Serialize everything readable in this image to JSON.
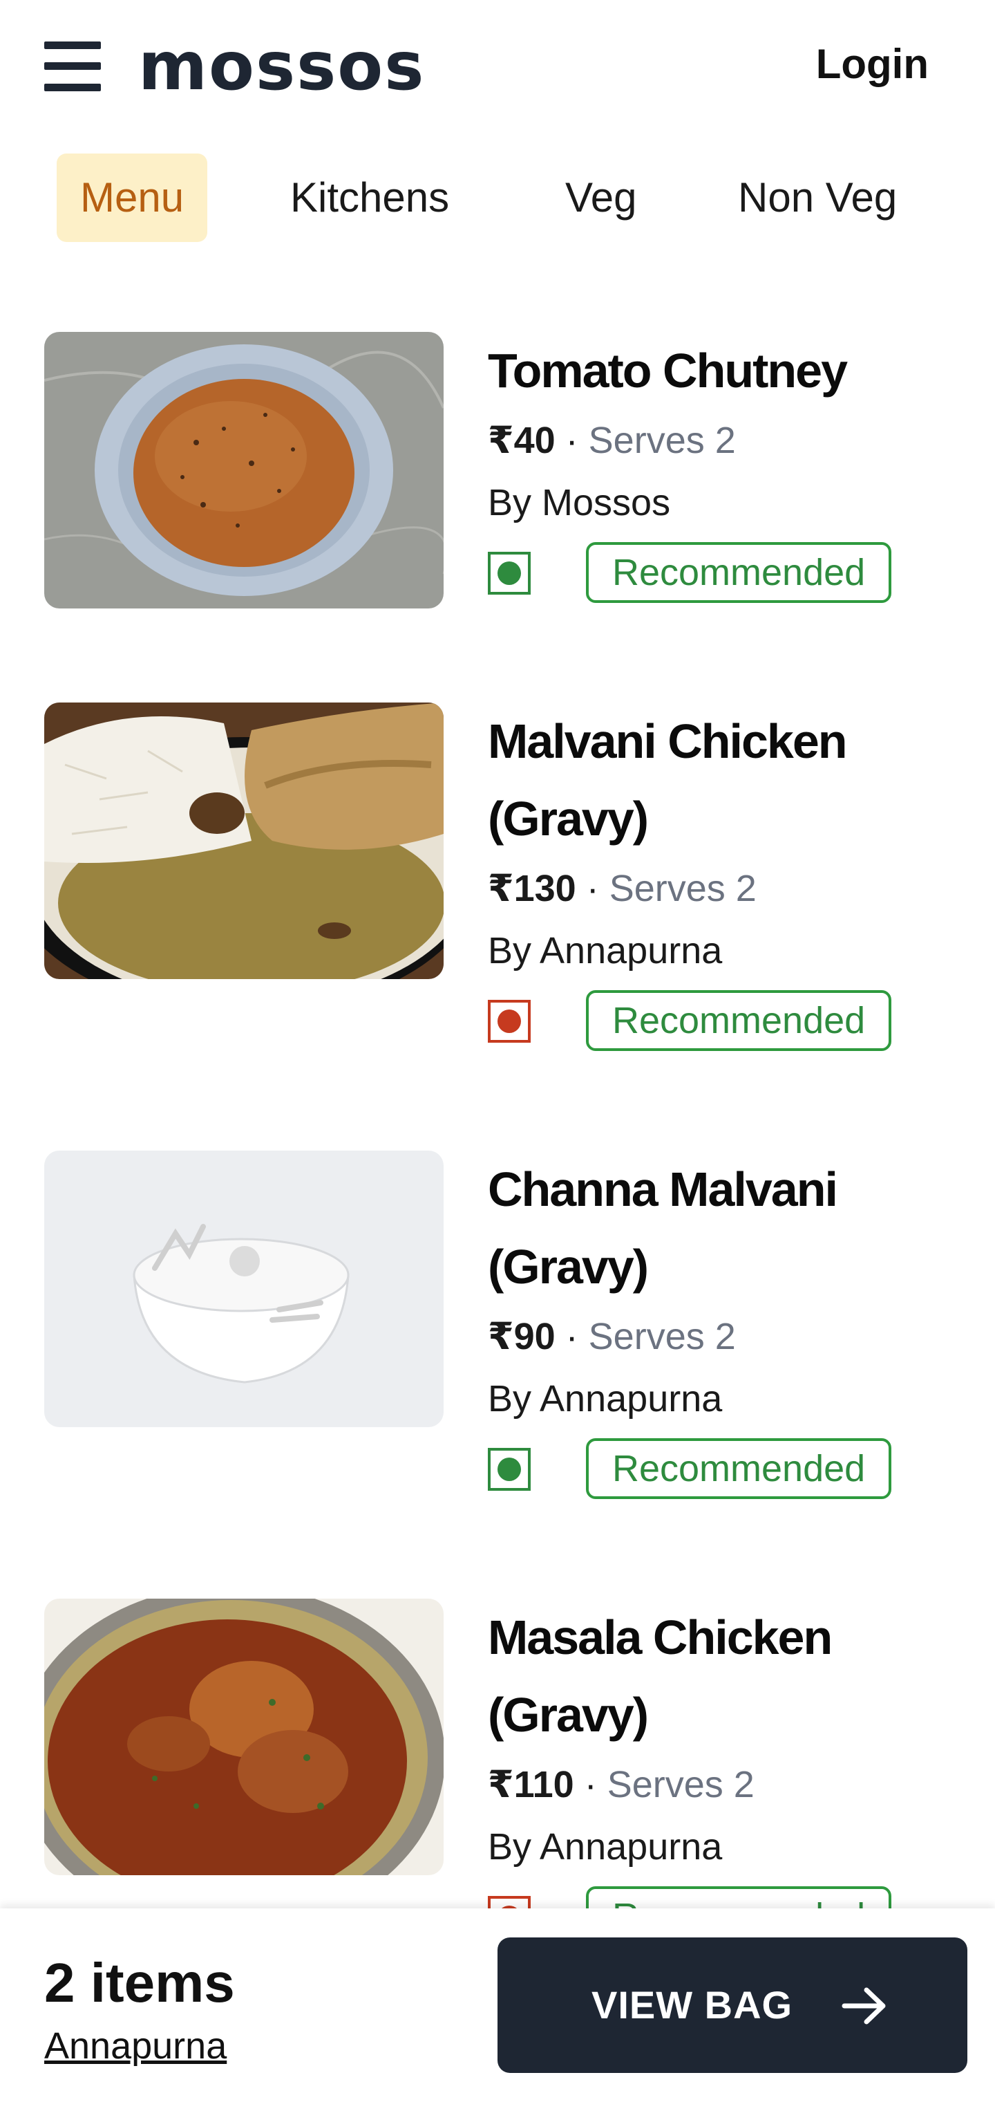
{
  "header": {
    "logo": "mossos",
    "login_label": "Login"
  },
  "tabs": [
    {
      "label": "Menu",
      "active": true
    },
    {
      "label": "Kitchens",
      "active": false
    },
    {
      "label": "Veg",
      "active": false
    },
    {
      "label": "Non Veg",
      "active": false
    }
  ],
  "items": [
    {
      "name": "Tomato Chutney",
      "price": "₹40",
      "sep": "·",
      "serves": "Serves 2",
      "by": "By Mossos",
      "diet": "veg",
      "badge": "Recommended"
    },
    {
      "name_line1": "Malvani Chicken",
      "name_line2": "(Gravy)",
      "price": "₹130",
      "sep": "·",
      "serves": "Serves 2",
      "by": "By Annapurna",
      "diet": "nonveg",
      "badge": "Recommended"
    },
    {
      "name_line1": "Channa Malvani",
      "name_line2": "(Gravy)",
      "price": "₹90",
      "sep": "·",
      "serves": "Serves 2",
      "by": "By Annapurna",
      "diet": "veg",
      "badge": "Recommended"
    },
    {
      "name_line1": "Masala Chicken",
      "name_line2": "(Gravy)",
      "price": "₹110",
      "sep": "·",
      "serves": "Serves 2",
      "by": "By Annapurna",
      "diet": "nonveg",
      "badge": "Recommended"
    }
  ],
  "bag": {
    "count": "2 items",
    "kitchen": "Annapurna",
    "button_label": "VIEW BAG"
  },
  "colors": {
    "dark": "#1e2633",
    "veg": "#2e8b3e",
    "nonveg": "#c63a1f",
    "active_tab_bg": "#fdf0c8",
    "active_tab_text": "#b65f12"
  },
  "icons": [
    "hamburger-menu-icon",
    "veg-indicator-icon",
    "nonveg-indicator-icon",
    "arrow-right-icon"
  ]
}
